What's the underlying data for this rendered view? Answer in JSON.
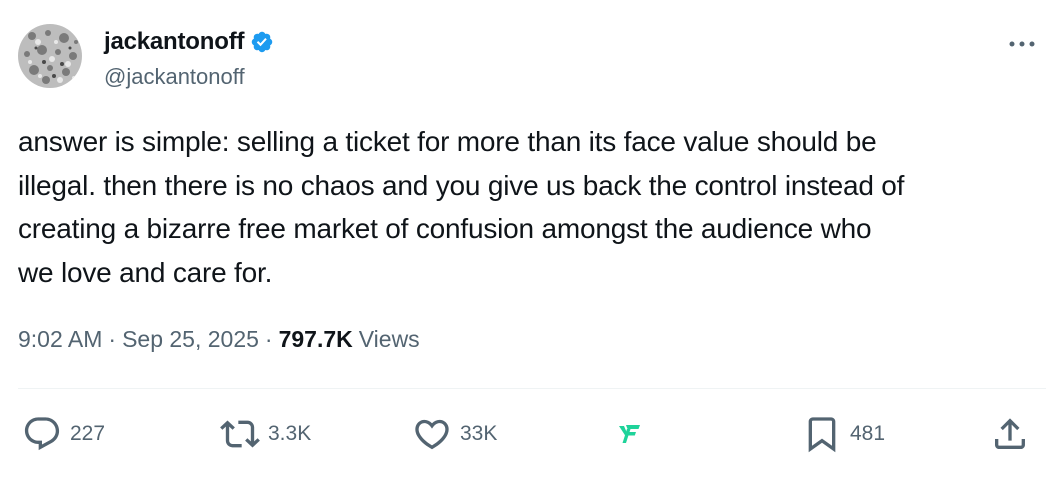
{
  "author": {
    "display_name": "jackantonoff",
    "handle": "@jackantonoff",
    "verified": true,
    "verified_color": "#1d9bf0",
    "avatar_icon": "avatar-image"
  },
  "tweet": {
    "text_lines": [
      "answer is simple: selling a ticket for more than its face value should be",
      "illegal. then there is no chaos and you give us back the control instead of",
      "creating a bizarre free market of confusion amongst the audience who",
      "we love and care for."
    ]
  },
  "meta": {
    "time": "9:02 AM",
    "separator": "·",
    "date": "Sep 25, 2025",
    "views_count": "797.7K",
    "views_label": "Views"
  },
  "actions": {
    "reply": {
      "icon": "reply-icon",
      "count": "227"
    },
    "retweet": {
      "icon": "retweet-icon",
      "count": "3.3K"
    },
    "like": {
      "icon": "heart-icon",
      "count": "33K"
    },
    "grok": {
      "icon": "grok-app-icon",
      "color": "#1fd39a"
    },
    "bookmark": {
      "icon": "bookmark-icon",
      "count": "481"
    },
    "share": {
      "icon": "share-icon"
    }
  },
  "colors": {
    "text": "#0f1419",
    "secondary": "#536471",
    "divider": "#eff3f4"
  }
}
